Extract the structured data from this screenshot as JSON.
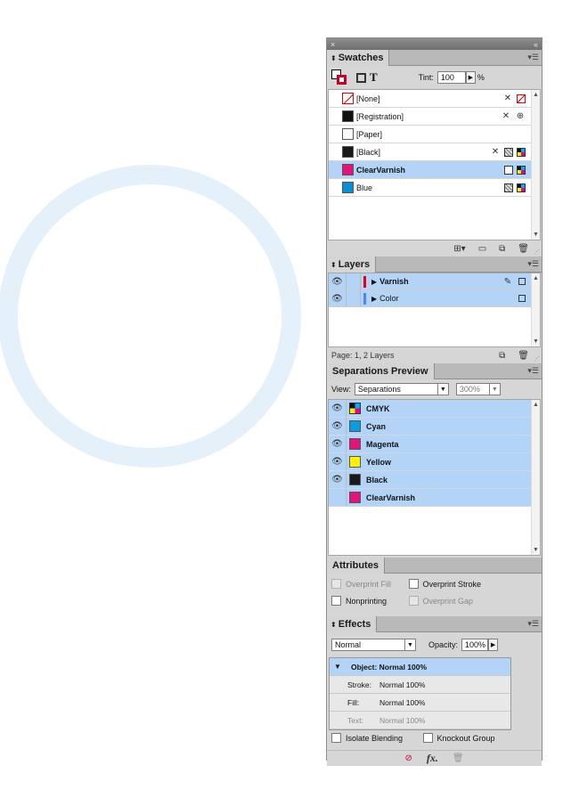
{
  "dock": {
    "collapse_glyph": "«",
    "close_glyph": "×"
  },
  "swatches": {
    "tab": "Swatches",
    "tint_label": "Tint:",
    "tint_value": "100",
    "tint_unit": "%",
    "items": [
      {
        "name": "[None]",
        "color": "none"
      },
      {
        "name": "[Registration]",
        "color": "#111111"
      },
      {
        "name": "[Paper]",
        "color": "#ffffff"
      },
      {
        "name": "[Black]",
        "color": "#1a1a1a"
      },
      {
        "name": "ClearVarnish",
        "color": "#e0147a"
      },
      {
        "name": "Blue",
        "color": "#0a8fd6"
      }
    ]
  },
  "layers": {
    "tab": "Layers",
    "items": [
      {
        "name": "Varnish",
        "color": "#e3001b"
      },
      {
        "name": "Color",
        "color": "#4f86f7"
      }
    ],
    "status": "Page: 1, 2 Layers"
  },
  "separations": {
    "tab": "Separations Preview",
    "view_label": "View:",
    "view_value": "Separations",
    "zoom_value": "300%",
    "items": [
      {
        "name": "CMYK",
        "color": "cmyk"
      },
      {
        "name": "Cyan",
        "color": "#0a9be0"
      },
      {
        "name": "Magenta",
        "color": "#e0147a"
      },
      {
        "name": "Yellow",
        "color": "#fff200"
      },
      {
        "name": "Black",
        "color": "#1a1a1a"
      },
      {
        "name": "ClearVarnish",
        "color": "#e0147a"
      }
    ]
  },
  "attributes": {
    "tab": "Attributes",
    "overprint_fill": "Overprint Fill",
    "overprint_stroke": "Overprint Stroke",
    "nonprinting": "Nonprinting",
    "overprint_gap": "Overprint Gap"
  },
  "effects": {
    "tab": "Effects",
    "blend_value": "Normal",
    "opacity_label": "Opacity:",
    "opacity_value": "100%",
    "object_row": "Object: Normal 100%",
    "rows": [
      {
        "k": "Stroke:",
        "v": "Normal 100%"
      },
      {
        "k": "Fill:",
        "v": "Normal 100%"
      },
      {
        "k": "Text:",
        "v": "Normal 100%"
      }
    ],
    "isolate_blending": "Isolate Blending",
    "knockout_group": "Knockout Group"
  }
}
